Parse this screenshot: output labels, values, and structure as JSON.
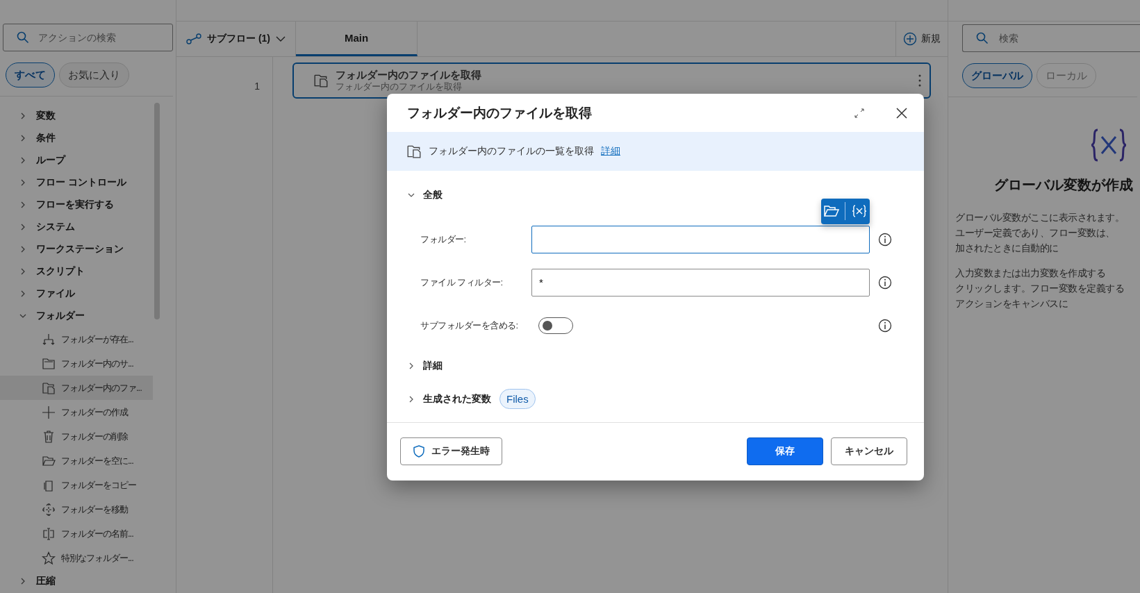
{
  "actions_panel": {
    "search": {
      "placeholder": "アクションの検索"
    },
    "filters": [
      {
        "label": "すべて",
        "selected": true
      },
      {
        "label": "お気に入り",
        "selected": false
      }
    ],
    "tree": [
      {
        "label": "変数",
        "expanded": false
      },
      {
        "label": "条件",
        "expanded": false
      },
      {
        "label": "ループ",
        "expanded": false
      },
      {
        "label": "フロー コントロール",
        "expanded": false
      },
      {
        "label": "フローを実行する",
        "expanded": false
      },
      {
        "label": "システム",
        "expanded": false
      },
      {
        "label": "ワークステーション",
        "expanded": false
      },
      {
        "label": "スクリプト",
        "expanded": false
      },
      {
        "label": "ファイル",
        "expanded": false
      },
      {
        "label": "フォルダー",
        "expanded": true,
        "children": [
          {
            "label": "フォルダーが存在...",
            "kind": "branch",
            "selected": false
          },
          {
            "label": "フォルダー内のサ...",
            "kind": "folders",
            "selected": false
          },
          {
            "label": "フォルダー内のファ...",
            "kind": "files",
            "selected": true
          },
          {
            "label": "フォルダーの作成",
            "kind": "plus",
            "selected": false
          },
          {
            "label": "フォルダーの削除",
            "kind": "trash",
            "selected": false
          },
          {
            "label": "フォルダーを空に...",
            "kind": "open",
            "selected": false
          },
          {
            "label": "フォルダーをコピー",
            "kind": "copy",
            "selected": false
          },
          {
            "label": "フォルダーを移動",
            "kind": "move",
            "selected": false
          },
          {
            "label": "フォルダーの名前...",
            "kind": "rename",
            "selected": false
          },
          {
            "label": "特別なフォルダー...",
            "kind": "star",
            "selected": false
          }
        ]
      },
      {
        "label": "圧縮",
        "expanded": false
      }
    ]
  },
  "canvas": {
    "subflow": "サブフロー (1)",
    "tabs": [
      {
        "label": "Main",
        "selected": true
      }
    ],
    "new_button": "新規",
    "steps": [
      {
        "number": "1",
        "title": "フォルダー内のファイルを取得",
        "subtitle": "フォルダー内のファイルを取得"
      }
    ]
  },
  "variables_panel": {
    "search": {
      "placeholder": "検索"
    },
    "filters": [
      {
        "label": "グローバル",
        "selected": true
      },
      {
        "label": "ローカル",
        "selected": false
      }
    ],
    "empty_title": "グローバル変数が作成",
    "paragraphs": [
      [
        "グローバル変数がここに表示されます。",
        "ユーザー定義であり、フロー変数は、",
        "加されたときに自動的に"
      ],
      [
        "入力変数または出力変数を作成する",
        "クリックします。フロー変数を定義する",
        "アクションをキャンバスに"
      ]
    ]
  },
  "dialog": {
    "title": "フォルダー内のファイルを取得",
    "description": "フォルダー内のファイルの一覧を取得",
    "details_link": "詳細",
    "sections": [
      {
        "label": "全般",
        "expanded": true
      },
      {
        "label": "詳細",
        "expanded": false
      },
      {
        "label": "生成された変数",
        "expanded": false,
        "tag": "Files"
      }
    ],
    "fields": [
      {
        "kind": "text",
        "label": "フォルダー:",
        "focused": true
      },
      {
        "kind": "text",
        "label": "ファイル フィルター:",
        "value": "*",
        "focused": false
      },
      {
        "kind": "toggle",
        "label": "サブフォルダーを含める:",
        "on": false
      }
    ],
    "error_button": "エラー発生時",
    "save_button": "保存",
    "cancel_button": "キャンセル"
  }
}
